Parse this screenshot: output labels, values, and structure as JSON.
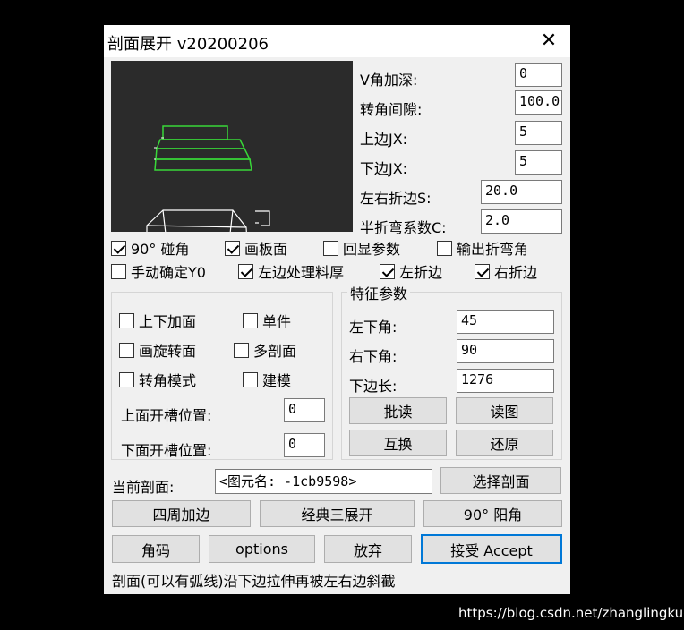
{
  "window": {
    "title": "剖面展开 v20200206"
  },
  "params": [
    {
      "label": "V角加深:",
      "value": "0"
    },
    {
      "label": "转角间隙:",
      "value": "100.0"
    },
    {
      "label": "上边JX:",
      "value": "5"
    },
    {
      "label": "下边JX:",
      "value": "5"
    },
    {
      "label": "左右折边S:",
      "value": "20.0"
    },
    {
      "label": "半折弯系数C:",
      "value": "2.0"
    }
  ],
  "checks": [
    {
      "label": "90° 碰角",
      "checked": true
    },
    {
      "label": "画板面",
      "checked": true
    },
    {
      "label": "回显参数",
      "checked": false
    },
    {
      "label": "输出折弯角",
      "checked": false
    },
    {
      "label": "手动确定Y0",
      "checked": false
    },
    {
      "label": "左边处理料厚",
      "checked": true
    },
    {
      "label": "左折边",
      "checked": true
    },
    {
      "label": "右折边",
      "checked": true
    }
  ],
  "left_group": {
    "checks": [
      {
        "label": "上下加面",
        "checked": false
      },
      {
        "label": "单件",
        "checked": false
      },
      {
        "label": "画旋转面",
        "checked": false
      },
      {
        "label": "多剖面",
        "checked": false
      },
      {
        "label": "转角模式",
        "checked": false
      },
      {
        "label": "建模",
        "checked": false
      }
    ],
    "upper_slot_label": "上面开槽位置:",
    "upper_slot_value": "0",
    "lower_slot_label": "下面开槽位置:",
    "lower_slot_value": "0"
  },
  "feature_group": {
    "title": "特征参数",
    "left_angle_label": "左下角:",
    "left_angle_value": "45",
    "right_angle_label": "右下角:",
    "right_angle_value": "90",
    "bottom_len_label": "下边长:",
    "bottom_len_value": "1276",
    "batch_read": "批读",
    "read_drawing": "读图",
    "swap": "互换",
    "restore": "还原"
  },
  "current_section": {
    "label": "当前剖面:",
    "value": "<图元名: -1cb9598>",
    "select_button": "选择剖面"
  },
  "actions_row1": [
    "四周加边",
    "经典三展开",
    "90° 阳角"
  ],
  "actions_row2": {
    "corner_code": "角码",
    "options": "options",
    "abandon": "放弃",
    "accept": "接受 Accept"
  },
  "status_text": "剖面(可以有弧线)沿下边拉伸再被左右边斜截",
  "watermark": "https://blog.csdn.net/zhanglingkuo",
  "colors": {
    "preview_bg": "#2b2b2b",
    "shape_green": "#39d739",
    "shape_white": "#ffffff",
    "default_button_border": "#0078d7"
  },
  "icons": {
    "close": "close-icon",
    "check": "checkmark-icon"
  }
}
